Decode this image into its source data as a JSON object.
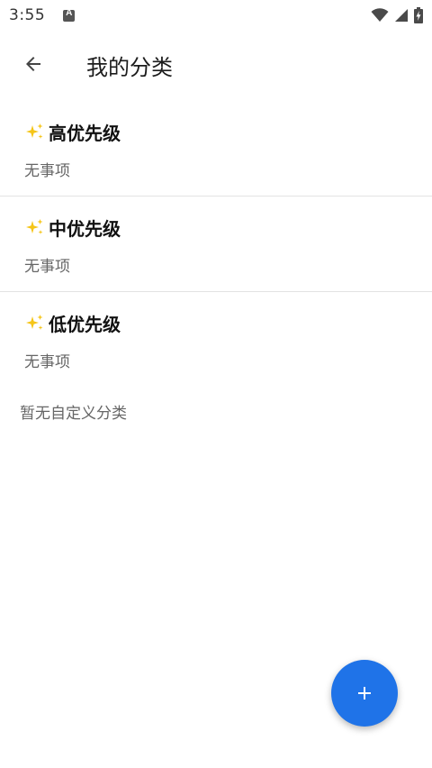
{
  "status_bar": {
    "time": "3:55",
    "icons": [
      "app-notification-icon",
      "wifi-icon",
      "cell-signal-icon",
      "battery-charging-icon"
    ]
  },
  "app_bar": {
    "back_icon": "arrow-left-icon",
    "title": "我的分类"
  },
  "categories": [
    {
      "icon": "sparkle-icon",
      "name": "高优先级",
      "subtitle": "无事项"
    },
    {
      "icon": "sparkle-icon",
      "name": "中优先级",
      "subtitle": "无事项"
    },
    {
      "icon": "sparkle-icon",
      "name": "低优先级",
      "subtitle": "无事项"
    }
  ],
  "custom_categories": {
    "empty_text": "暂无自定义分类"
  },
  "fab": {
    "icon": "plus-icon"
  },
  "colors": {
    "accent": "#1f73e8",
    "sparkle": "#f5c518",
    "divider": "#e3e3e3"
  }
}
